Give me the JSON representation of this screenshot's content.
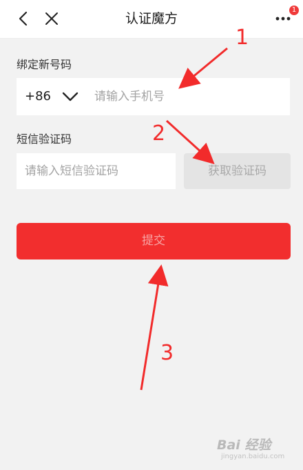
{
  "nav": {
    "title": "认证魔方",
    "badge_count": "1"
  },
  "bind_phone": {
    "label": "绑定新号码",
    "country_code": "+86",
    "phone_placeholder": "请输入手机号"
  },
  "sms": {
    "label": "短信验证码",
    "code_placeholder": "请输入短信验证码",
    "get_code_label": "获取验证码"
  },
  "submit_label": "提交",
  "annotations": [
    "1",
    "2",
    "3"
  ],
  "watermark": {
    "brand": "Bai 经验",
    "url": "jingyan.baidu.com"
  },
  "colors": {
    "accent": "#f22e2e",
    "badge": "#f03a3a",
    "annotation": "#f22b2b"
  }
}
